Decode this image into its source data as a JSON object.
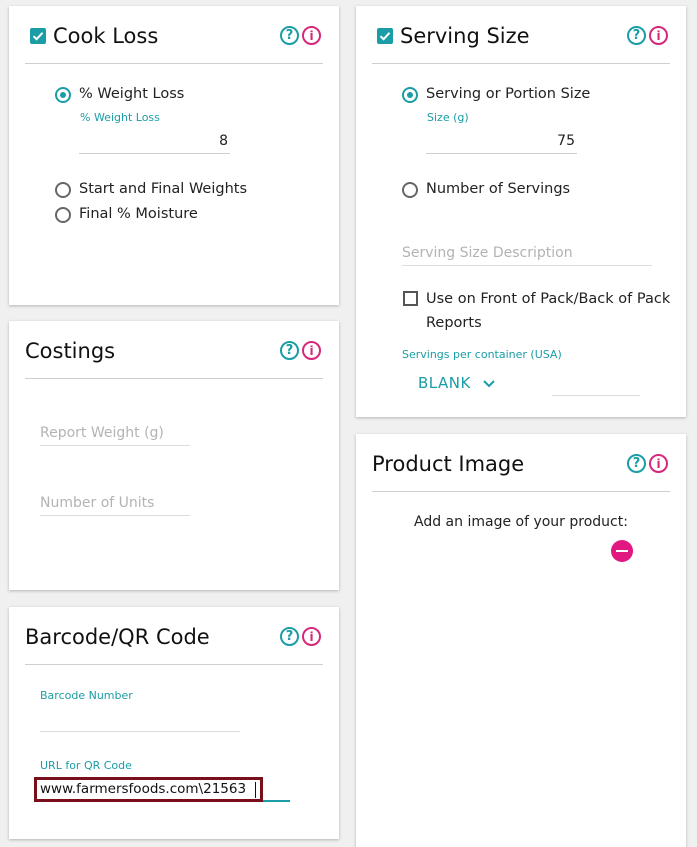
{
  "cook_loss": {
    "title": "Cook Loss",
    "options": [
      {
        "label": "% Weight Loss",
        "selected": true
      },
      {
        "label": "Start and Final Weights",
        "selected": false
      },
      {
        "label": "Final % Moisture",
        "selected": false
      }
    ],
    "weight_loss_label": "% Weight Loss",
    "weight_loss_value": "8"
  },
  "serving_size": {
    "title": "Serving Size",
    "opt_portion": "Serving or Portion Size",
    "size_label": "Size (g)",
    "size_value": "75",
    "opt_number": "Number of Servings",
    "description_placeholder": "Serving Size Description",
    "front_back_label": "Use on Front of Pack/Back of Pack",
    "front_back_label_2": "Reports",
    "servings_per_container_label": "Servings per container (USA)",
    "dropdown_value": "BLANK"
  },
  "costings": {
    "title": "Costings",
    "report_weight_placeholder": "Report Weight (g)",
    "units_placeholder": "Number of Units"
  },
  "product_image": {
    "title": "Product Image",
    "prompt": "Add an image of your product:"
  },
  "barcode": {
    "title": "Barcode/QR Code",
    "barcode_label": "Barcode Number",
    "qr_label": "URL for QR Code",
    "qr_value": "www.farmersfoods.com\\21563"
  },
  "colors": {
    "accent": "#1a9da6",
    "info": "#d6287a",
    "highlight_border": "#7a0f1c"
  },
  "icons": [
    "checkbox-checked-icon",
    "help-icon",
    "info-icon",
    "chevron-down-icon",
    "remove-icon"
  ]
}
